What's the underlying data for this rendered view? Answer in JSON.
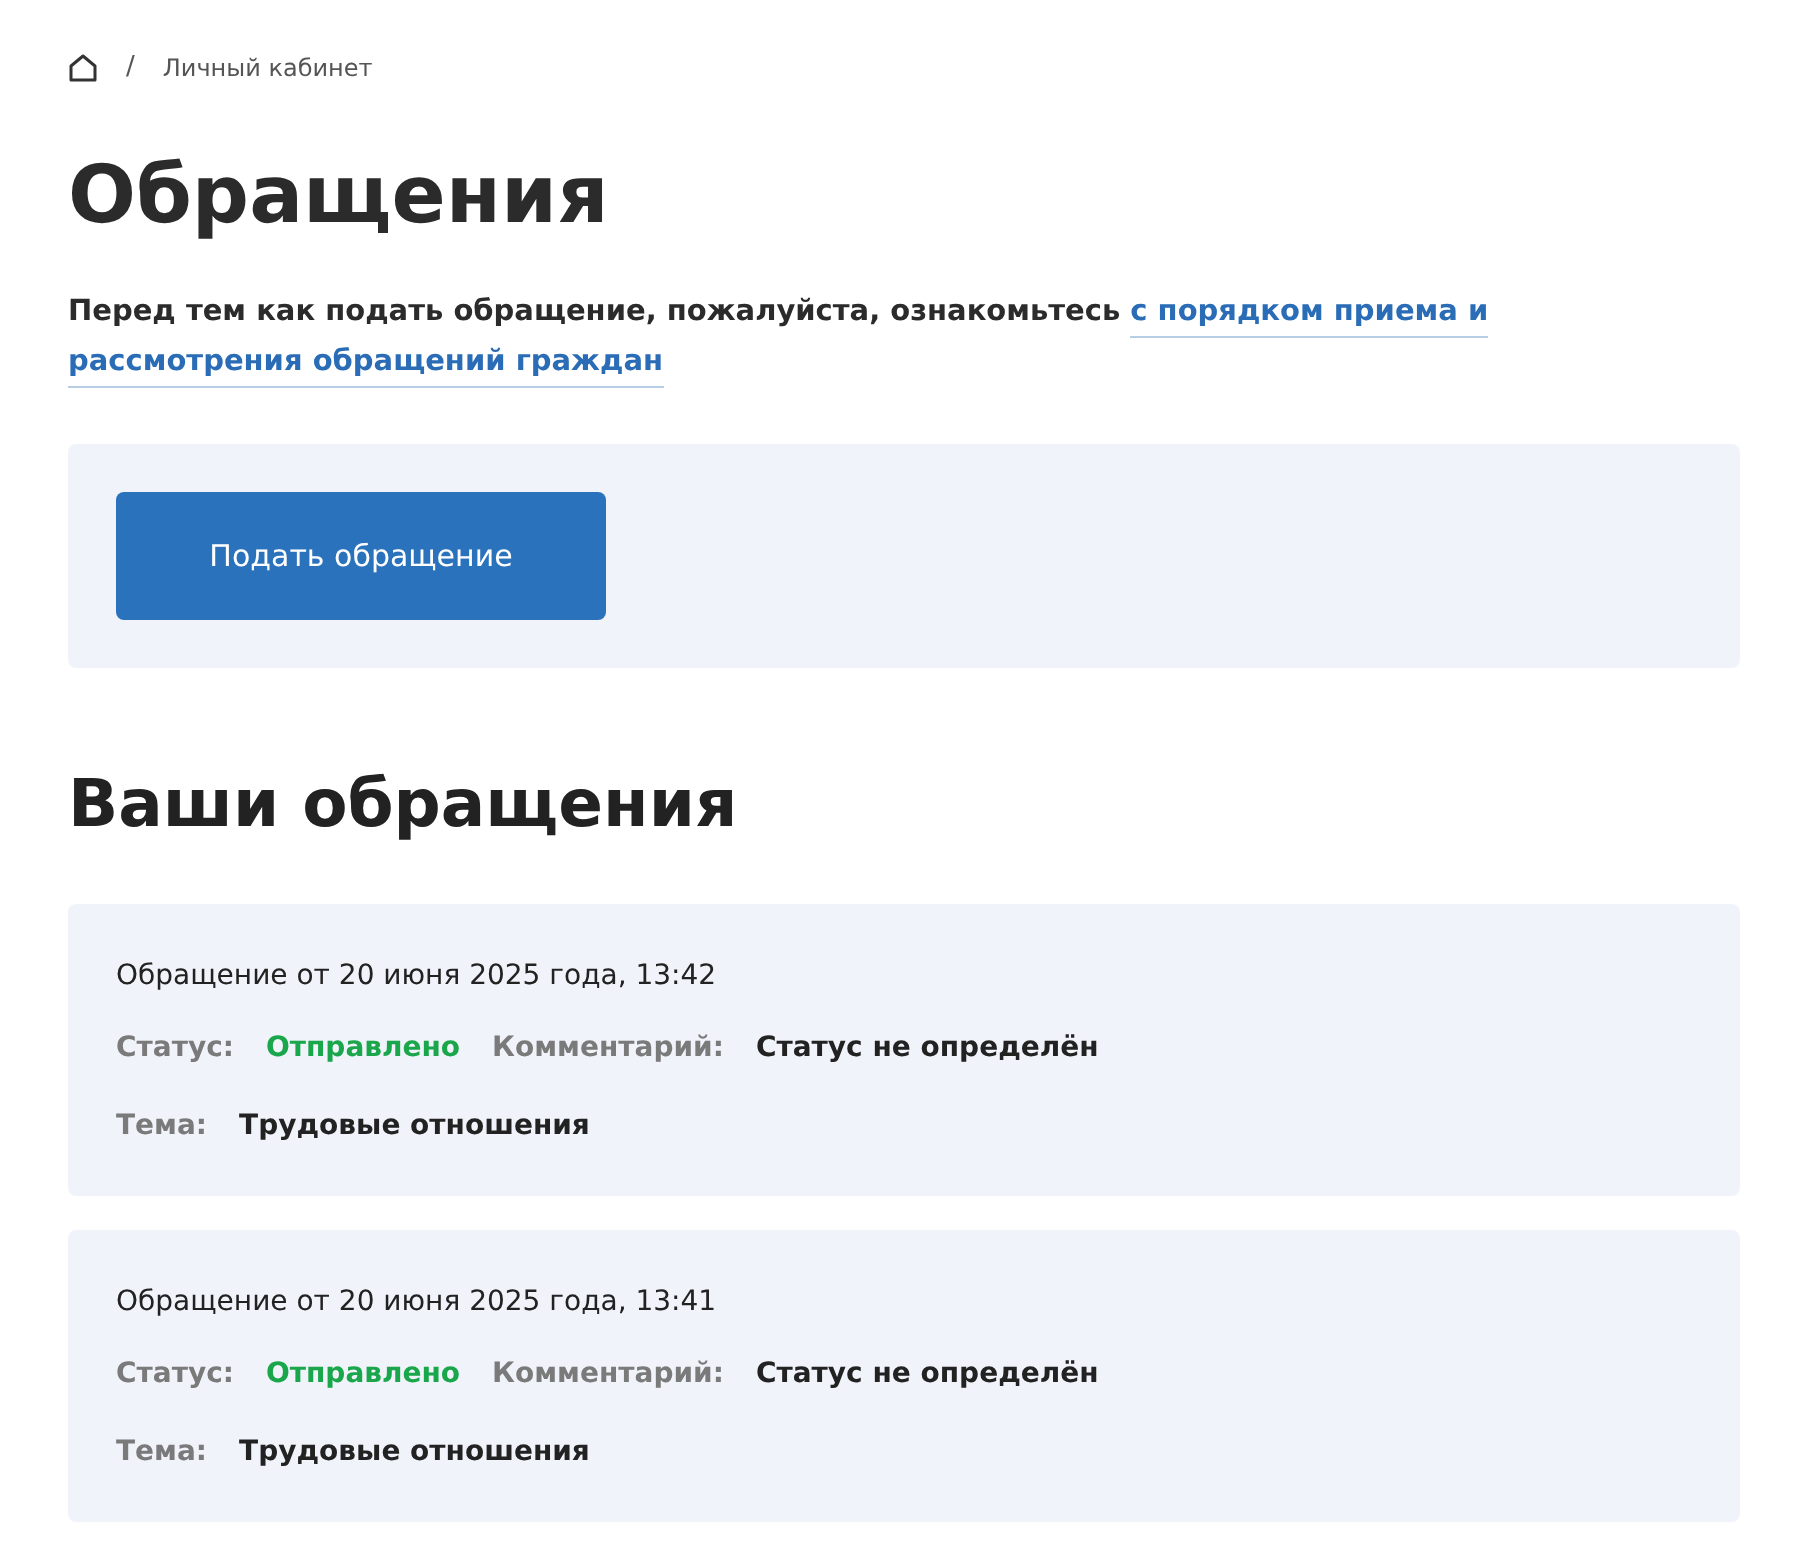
{
  "breadcrumb": {
    "separator": "/",
    "current": "Личный кабинет"
  },
  "title": "Обращения",
  "intro": {
    "text": "Перед тем как подать обращение, пожалуйста, ознакомьтесь",
    "link_lines": [
      "с порядком приема и",
      "рассмотрения обращений граждан"
    ]
  },
  "submit_button": "Подать обращение",
  "list_title": "Ваши обращения",
  "requests": [
    {
      "title": "Обращение от 20 июня 2025 года, 13:42",
      "status_label": "Статус:",
      "status": {
        "text": "Отправлено",
        "color": "#1aa64a"
      },
      "comment_label": "Комментарий:",
      "comment": "Статус не определён",
      "topic_label": "Тема:",
      "topic": "Трудовые отношения"
    },
    {
      "title": "Обращение от 20 июня 2025 года, 13:41",
      "status_label": "Статус:",
      "status": {
        "text": "Отправлено",
        "color": "#1aa64a"
      },
      "comment_label": "Комментарий:",
      "comment": "Статус не определён",
      "topic_label": "Тема:",
      "topic": "Трудовые отношения"
    }
  ]
}
